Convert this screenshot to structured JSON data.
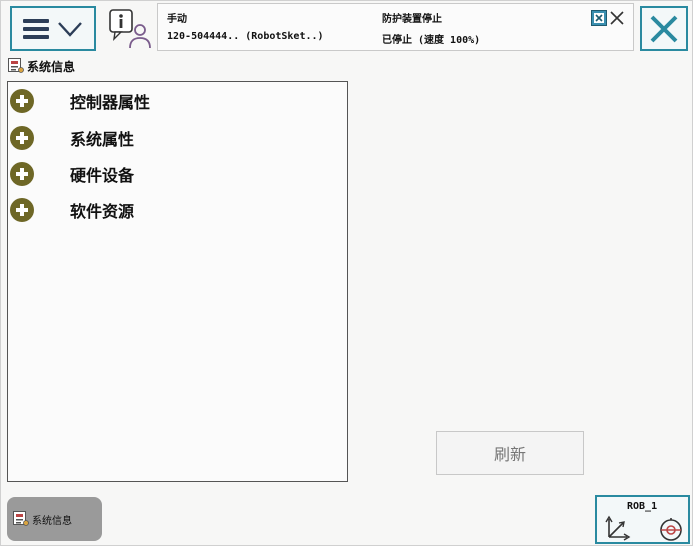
{
  "header": {
    "mode": "手动",
    "controller": "120-504444.. (RobotSket..)",
    "safety_status": "防护装置停止",
    "motor_status": "已停止 (速度 100%)"
  },
  "app": {
    "title": "系统信息"
  },
  "tree": {
    "items": [
      {
        "label": "控制器属性"
      },
      {
        "label": "系统属性"
      },
      {
        "label": "硬件设备"
      },
      {
        "label": "软件资源"
      }
    ]
  },
  "actions": {
    "refresh_label": "刷新"
  },
  "taskbar": {
    "tab_label": "系统信息"
  },
  "quickset": {
    "mech_unit": "ROB_1"
  },
  "colors": {
    "accent": "#2a8aa0",
    "expand_icon": "#6e6726",
    "menu_icon": "#2c3e58"
  },
  "icons": {
    "menu": "hamburger-menu-icon",
    "menu_chevron": "chevron-down-icon",
    "status": "info-person-icon",
    "close": "close-x-icon",
    "app": "system-info-icon",
    "expand": "plus-circle-icon",
    "quickset_axes": "coordinate-axes-icon",
    "quickset_tool": "tool-speed-icon"
  }
}
